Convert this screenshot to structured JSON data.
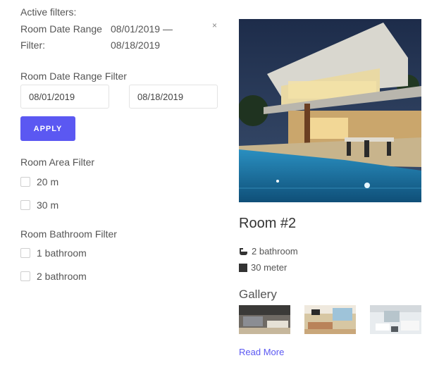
{
  "active_filters": {
    "title": "Active filters:",
    "filter_label": "Room Date Range Filter:",
    "filter_value": "08/01/2019 — 08/18/2019",
    "remove_label": "×"
  },
  "date_filter": {
    "title": "Room Date Range Filter",
    "from_value": "08/01/2019",
    "to_value": "08/18/2019",
    "apply_label": "APPLY"
  },
  "area_filter": {
    "title": "Room Area Filter",
    "options": [
      "20 m",
      "30 m"
    ]
  },
  "bathroom_filter": {
    "title": "Room Bathroom Filter",
    "options": [
      "1 bathroom",
      "2 bathroom"
    ]
  },
  "room": {
    "title": "Room #2",
    "bathroom": "2 bathroom",
    "area": "30 meter",
    "bathroom_icon": "bathtub-icon",
    "area_icon": "square-icon",
    "gallery_title": "Gallery",
    "read_more": "Read More"
  },
  "colors": {
    "accent": "#5b58f2"
  }
}
